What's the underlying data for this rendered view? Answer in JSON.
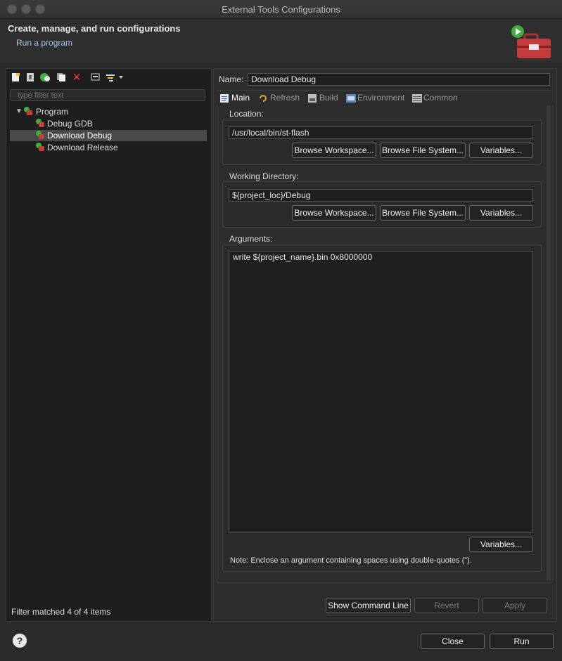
{
  "window": {
    "title": "External Tools Configurations"
  },
  "header": {
    "title": "Create, manage, and run configurations",
    "subtitle": "Run a program"
  },
  "left": {
    "toolbar_icons": [
      "new-config-icon",
      "new-prototype-icon",
      "export-icon",
      "duplicate-icon",
      "delete-icon",
      "collapse-all-icon",
      "filter-icon"
    ],
    "filter_placeholder": "type filter text",
    "tree": {
      "root": "Program",
      "children": [
        "Debug GDB",
        "Download Debug",
        "Download Release"
      ],
      "selected": "Download Debug"
    },
    "status": "Filter matched 4 of 4 items"
  },
  "right": {
    "name_label": "Name:",
    "name_value": "Download Debug",
    "tabs": [
      "Main",
      "Refresh",
      "Build",
      "Environment",
      "Common"
    ],
    "active_tab": "Main",
    "location": {
      "label": "Location:",
      "value": "/usr/local/bin/st-flash",
      "buttons": [
        "Browse Workspace...",
        "Browse File System...",
        "Variables..."
      ]
    },
    "workdir": {
      "label": "Working Directory:",
      "value": "${project_loc}/Debug",
      "buttons": [
        "Browse Workspace...",
        "Browse File System...",
        "Variables..."
      ]
    },
    "arguments": {
      "label": "Arguments:",
      "value": "write ${project_name}.bin 0x8000000",
      "variables_button": "Variables...",
      "note": "Note: Enclose an argument containing spaces using double-quotes (\")."
    },
    "actions": {
      "show_cmd": "Show Command Line",
      "revert": "Revert",
      "apply": "Apply"
    }
  },
  "footer": {
    "close": "Close",
    "run": "Run",
    "help": "?"
  }
}
